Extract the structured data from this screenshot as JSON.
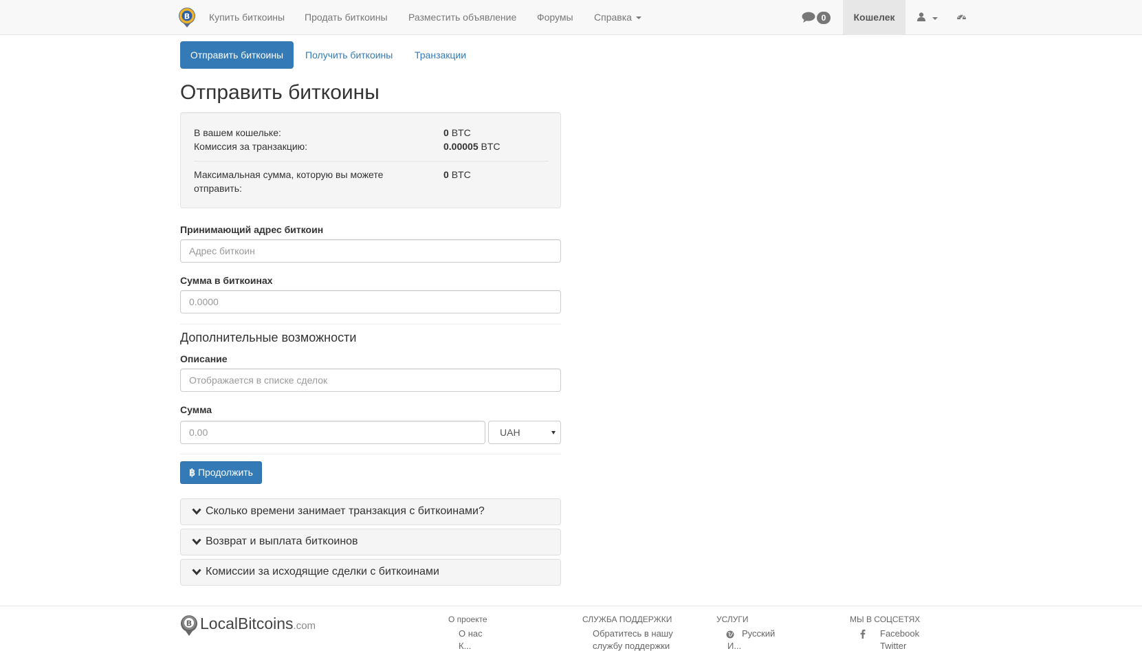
{
  "navbar": {
    "links": [
      "Купить биткоины",
      "Продать биткоины",
      "Разместить объявление",
      "Форумы",
      "Справка"
    ],
    "messages_count": "0",
    "wallet": "Кошелек"
  },
  "tabs": {
    "send": "Отправить биткоины",
    "receive": "Получить биткоины",
    "transactions": "Транзакции"
  },
  "page_title": "Отправить биткоины",
  "wallet_info": {
    "balance_label": "В вашем кошельке:",
    "balance_value": "0",
    "fee_label": "Комиссия за транзакцию:",
    "fee_value": "0.00005",
    "max_label_line1": "Максимальная сумма, которую вы можете",
    "max_label_line2": "отправить:",
    "max_value": "0",
    "unit": "BTC"
  },
  "form": {
    "address_label": "Принимающий адрес биткоин",
    "address_placeholder": "Адрес биткоин",
    "amount_label": "Сумма в биткоинах",
    "amount_placeholder": "0.0000",
    "extra_title": "Дополнительные возможности",
    "description_label": "Описание",
    "description_placeholder": "Отображается в списке сделок",
    "fiat_label": "Сумма",
    "fiat_placeholder": "0.00",
    "currency": "UAH",
    "submit_symbol": "฿",
    "submit": "Продолжить"
  },
  "faq": [
    "Сколько времени занимает транзакция с биткоинами?",
    "Возврат и выплата биткоинов",
    "Комиссии за исходящие сделки с биткоинами"
  ],
  "footer": {
    "brand": "LocalBitcoins",
    "brand_tld": ".com",
    "col1_head": "О проекте",
    "col1_item": "О нас",
    "col1_item2": "К...",
    "col2_head": "СЛУЖБА ПОДДЕРЖКИ",
    "col2_item": "Обратитесь в нашу",
    "col2_item2": "службу поддержки",
    "col3_head": "УСЛУГИ",
    "col3_item": "Русский",
    "col3_item2": "И...",
    "col4_head": "МЫ В СОЦСЕТЯХ",
    "col4_item": "Facebook",
    "col4_item2": "Twitter"
  },
  "colors": {
    "primary": "#337ab7",
    "navbar_bg": "#f8f8f8",
    "well_bg": "#f5f5f5",
    "logo_gold": "#f0b429"
  }
}
